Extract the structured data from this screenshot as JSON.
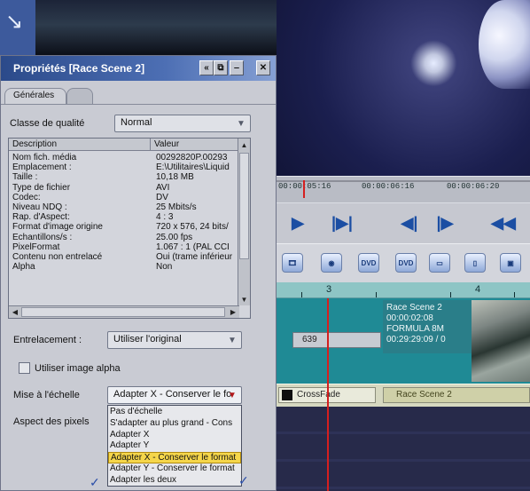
{
  "dialog": {
    "title": "Propriétés [Race Scene 2]",
    "titlebar_buttons": [
      "«",
      "⧉",
      "‒",
      "✕"
    ],
    "tabs": [
      {
        "label": "Générales"
      },
      {
        "label": ""
      }
    ],
    "quality_class": {
      "label": "Classe de qualité",
      "value": "Normal"
    },
    "table": {
      "headers": [
        "Description",
        "Valeur"
      ],
      "rows": [
        [
          "Nom fich. média",
          "00292820P.00293"
        ],
        [
          "Emplacement :",
          "E:\\Utilitaires\\Liquid"
        ],
        [
          "Taille :",
          "10,18 MB"
        ],
        [
          "Type de fichier",
          "AVI"
        ],
        [
          "Codec:",
          "DV"
        ],
        [
          "Niveau NDQ :",
          "25 Mbits/s"
        ],
        [
          "Rap. d'Aspect:",
          "4 : 3"
        ],
        [
          "Format d'image origine",
          "720 x 576, 24 bits/"
        ],
        [
          "Echantillons/s :",
          "25.00 fps"
        ],
        [
          "PixelFormat",
          "1.067 : 1 (PAL CCI"
        ],
        [
          "Contenu non entrelacé",
          "Oui (trame inférieur"
        ],
        [
          "Alpha",
          "Non"
        ]
      ]
    },
    "interlacing": {
      "label": "Entrelacement :",
      "value": "Utiliser l'original"
    },
    "use_alpha": {
      "label": "Utiliser image alpha",
      "checked": false
    },
    "scaling": {
      "label": "Mise à l'échelle",
      "value": "Adapter X - Conserver le fo",
      "options": [
        "Pas d'échelle",
        "S'adapter au plus grand - Cons",
        "Adapter X",
        "Adapter Y",
        "Adapter X - Conserver le format",
        "Adapter Y - Conserver le format",
        "Adapter les deux"
      ],
      "selected_index": 4
    },
    "pixel_aspect": {
      "label": "Aspect des pixels"
    }
  },
  "timeline": {
    "timecodes": [
      "00:00:05:16",
      "00:00:06:16",
      "00:00:06:20"
    ],
    "ruler_numbers": [
      "3",
      "4"
    ],
    "clip_small": {
      "label": "639"
    },
    "clip_race": {
      "lines": [
        "Race Scene 2",
        "00:00:02:08",
        "FORMULA 8M",
        "00:29:29:09 / 0"
      ]
    },
    "transition": {
      "label": "CrossFade",
      "right_label": "Race Scene 2"
    },
    "toolbar_icons": [
      "film-icon",
      "globe-icon",
      "dvd-icon",
      "dvd-burn-icon",
      "folder-icon",
      "phone-icon",
      "save-icon"
    ],
    "transport": [
      "▶",
      "|▶|",
      "◀|",
      "|▶",
      "◀◀"
    ]
  },
  "colors": {
    "accent": "#2b4a8a",
    "playhead": "#d51f1f",
    "selection": "#f5d64a",
    "track": "#1f8a95"
  }
}
